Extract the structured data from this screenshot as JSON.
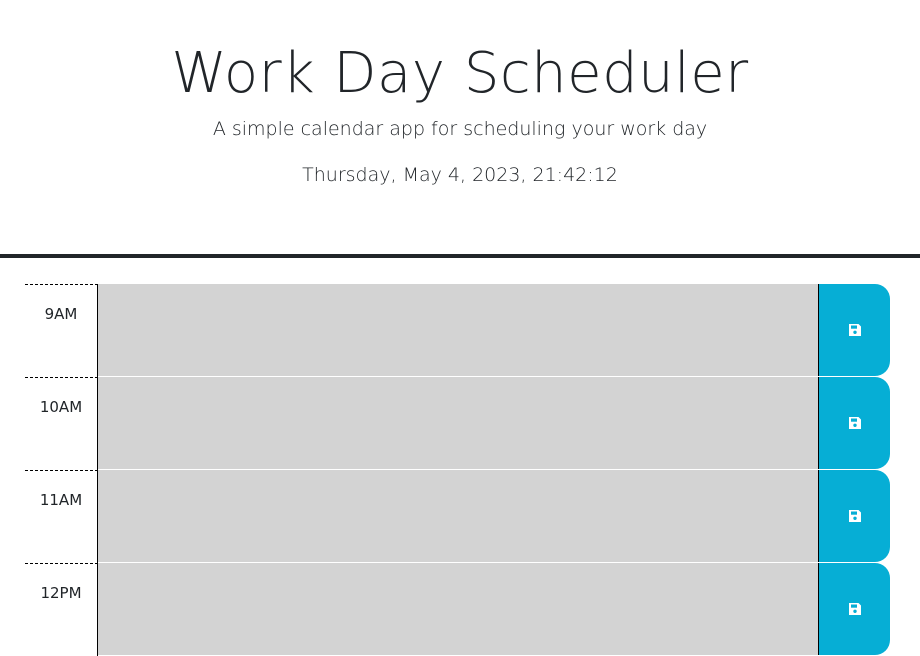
{
  "header": {
    "title": "Work Day Scheduler",
    "subtitle": "A simple calendar app for scheduling your work day",
    "current_datetime": "Thursday, May 4, 2023, 21:42:12"
  },
  "colors": {
    "past": "#d3d3d3",
    "save_button": "#06aed5",
    "divider": "#212529"
  },
  "timeblocks": [
    {
      "hour": "9AM",
      "description": "",
      "status": "past",
      "save_icon": "floppy-disk-icon"
    },
    {
      "hour": "10AM",
      "description": "",
      "status": "past",
      "save_icon": "floppy-disk-icon"
    },
    {
      "hour": "11AM",
      "description": "",
      "status": "past",
      "save_icon": "floppy-disk-icon"
    },
    {
      "hour": "12PM",
      "description": "",
      "status": "past",
      "save_icon": "floppy-disk-icon"
    }
  ]
}
